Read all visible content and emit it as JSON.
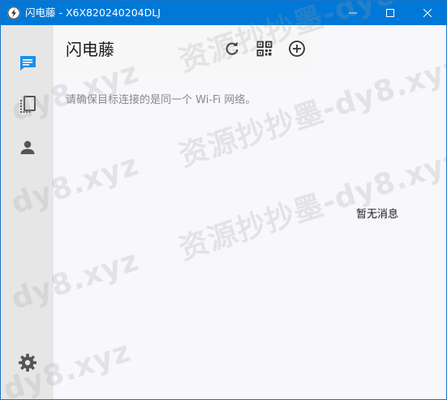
{
  "window": {
    "title": "闪电藤 - X6X820240204DLJ"
  },
  "sidebar": {
    "items": [
      {
        "name": "chat",
        "icon": "chat-bubble-icon",
        "active": true
      },
      {
        "name": "devices",
        "icon": "devices-icon",
        "active": false
      },
      {
        "name": "contacts",
        "icon": "person-icon",
        "active": false
      }
    ],
    "settings_icon": "gear-icon"
  },
  "header": {
    "title": "闪电藤",
    "actions": [
      "refresh-icon",
      "qr-code-icon",
      "add-circle-icon"
    ]
  },
  "main": {
    "hint": "请确保目标连接的是同一个 Wi-Fi 网络。",
    "empty_message": "暂无消息"
  },
  "watermarks": [
    "资源抄抄墨-dy8.xyz",
    "dy8.xyz",
    "资源抄抄墨-dy8.xyz",
    "dy8.xyz",
    "资源抄抄墨-dy8.xyz",
    "dy8.xyz",
    "dy8.xyz"
  ],
  "colors": {
    "titlebar": "#0078d7",
    "accent": "#1e90e8",
    "sidebar_bg": "#e6e6e6",
    "main_bg": "#f7f7fc"
  }
}
